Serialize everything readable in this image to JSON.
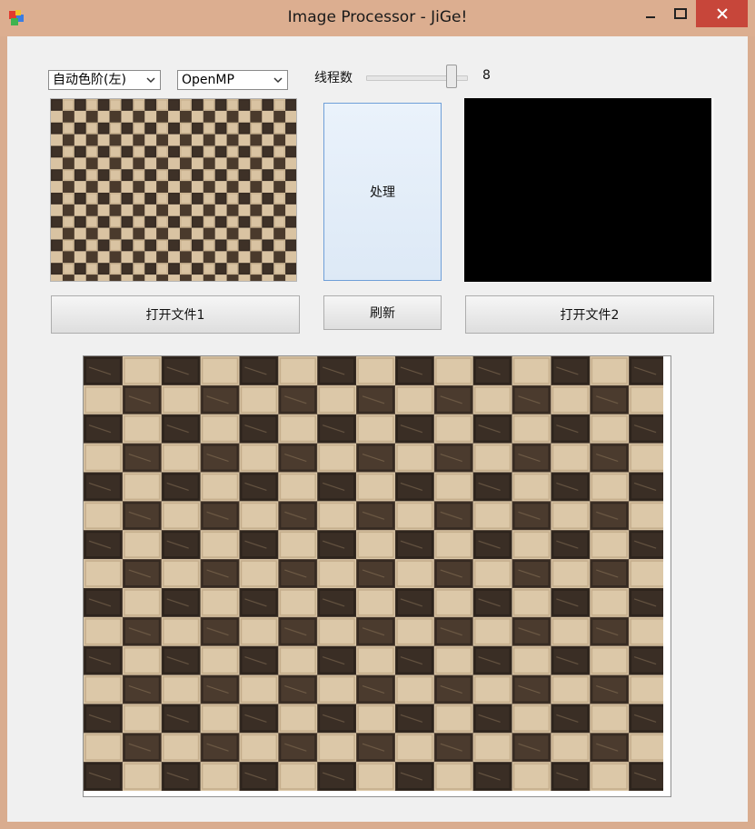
{
  "window": {
    "title": "Image Processor - JiGe!"
  },
  "controls": {
    "algorithm_select": "自动色阶(左)",
    "backend_select": "OpenMP",
    "threads_label": "线程数",
    "threads_value": "8",
    "threads_slider_level": 1.0
  },
  "buttons": {
    "process": "处理",
    "open_file_1": "打开文件1",
    "refresh": "刷新",
    "open_file_2": "打开文件2"
  },
  "colors": {
    "window_frame": "#d9ac8f",
    "client_bg": "#f0f0f0",
    "close_button": "#c7463a",
    "output_preview": "#000000"
  },
  "icons": {
    "app": "app-icon",
    "minimize": "minimize-icon",
    "maximize": "maximize-icon",
    "close": "close-icon",
    "dropdown": "chevron-down-icon"
  }
}
